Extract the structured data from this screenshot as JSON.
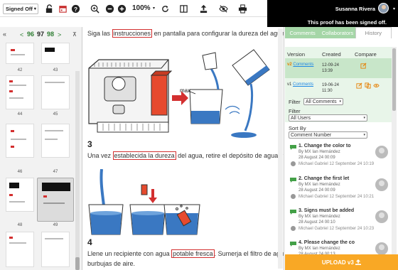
{
  "toolbar": {
    "signed_label": "Signed Off",
    "zoom": "100%"
  },
  "user": {
    "name": "Susanna Rivera"
  },
  "notice": "This proof has been signed off.",
  "pager": {
    "prev_page": "96",
    "current_page": "97",
    "next_page": "98"
  },
  "thumbnails": [
    {
      "label": "42"
    },
    {
      "label": "43"
    },
    {
      "label": "44"
    },
    {
      "label": "45"
    },
    {
      "label": "46"
    },
    {
      "label": "47"
    },
    {
      "label": "48"
    },
    {
      "label": "49"
    }
  ],
  "document": {
    "line1_before": "Siga las ",
    "line1_highlight": "instrucciones",
    "line1_after": " en pantalla para configurar la dureza del agua tal",
    "max_label": "max",
    "step3": "3",
    "line2_before": "Una vez ",
    "line2_highlight": "establecida la dureza",
    "line2_after": " del agua, retire el depósito de agua y su",
    "step4": "4",
    "line3_before": "Llene un recipiente con agua ",
    "line3_highlight": "potable fresca",
    "line3_after": ". Sumerja el filtro de agua",
    "line4": "burbujas de aire."
  },
  "panel": {
    "tabs": [
      "Comments",
      "Collaborators",
      "History"
    ],
    "columns": [
      "Version",
      "Created",
      "Compare"
    ],
    "versions": [
      {
        "name": "v2",
        "link": "Comments",
        "date": "12-09-24",
        "time": "13:39"
      },
      {
        "name": "v1",
        "link": "Comments",
        "date": "19-06-24",
        "time": "11:30"
      }
    ],
    "filter_label": "Filter",
    "filter_value": "All Comments",
    "filter2_label": "Filter",
    "filter2_value": "All Users",
    "sort_label": "Sort By",
    "sort_value": "Comment Number",
    "comments": [
      {
        "title": "1. Change the color to",
        "by": "By MX Ian Hernández",
        "date": "28 August 24 00:09",
        "meta": "Michael Gabriel 12 September 24 10:19"
      },
      {
        "title": "2. Change the first let",
        "by": "By MX Ian Hernández",
        "date": "28 August 24 00:09",
        "meta": "Michael Gabriel 12 September 24 10:21"
      },
      {
        "title": "3. Signs must be added",
        "by": "By MX Ian Hernández",
        "date": "28 August 24 00:10",
        "meta": "Michael Gabriel 12 September 24 10:23"
      },
      {
        "title": "4. Please change the co",
        "by": "By MX Ian Hernández",
        "date": "28 August 24 00:13",
        "meta": ""
      }
    ],
    "upload_label": "UPLOAD v3"
  },
  "colors": {
    "accent_green": "#2e7d32",
    "upload_orange": "#f9a825",
    "highlight_red": "#d32f2f"
  },
  "icons": [
    "unlock-icon",
    "calendar-icon",
    "help-icon",
    "zoom-in-icon",
    "zoom-out-icon",
    "plus-icon",
    "refresh-icon",
    "columns-icon",
    "upload-icon",
    "eye-off-icon",
    "print-icon"
  ]
}
